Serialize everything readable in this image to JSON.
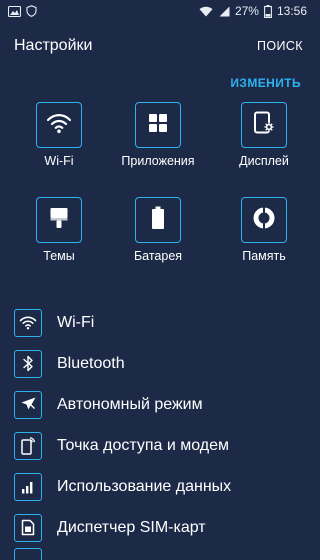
{
  "status_bar": {
    "battery_percent": "27%",
    "time": "13:56"
  },
  "header": {
    "title": "Настройки",
    "search_label": "ПОИСК"
  },
  "quick_settings": {
    "edit_label": "ИЗМЕНИТЬ",
    "tiles": [
      {
        "label": "Wi-Fi",
        "icon": "wifi-icon"
      },
      {
        "label": "Приложения",
        "icon": "apps-grid-icon"
      },
      {
        "label": "Дисплей",
        "icon": "display-icon"
      },
      {
        "label": "Темы",
        "icon": "themes-brush-icon"
      },
      {
        "label": "Батарея",
        "icon": "battery-icon"
      },
      {
        "label": "Память",
        "icon": "memory-icon"
      }
    ]
  },
  "settings_list": {
    "items": [
      {
        "label": "Wi-Fi",
        "icon": "wifi-icon"
      },
      {
        "label": "Bluetooth",
        "icon": "bluetooth-icon"
      },
      {
        "label": "Автономный режим",
        "icon": "airplane-icon"
      },
      {
        "label": "Точка доступа и модем",
        "icon": "hotspot-icon"
      },
      {
        "label": "Использование данных",
        "icon": "data-usage-icon"
      },
      {
        "label": "Диспетчер SIM-карт",
        "icon": "sim-card-icon"
      }
    ]
  },
  "colors": {
    "background": "#1c2a47",
    "accent": "#2bb3f0",
    "text": "#ffffff"
  }
}
